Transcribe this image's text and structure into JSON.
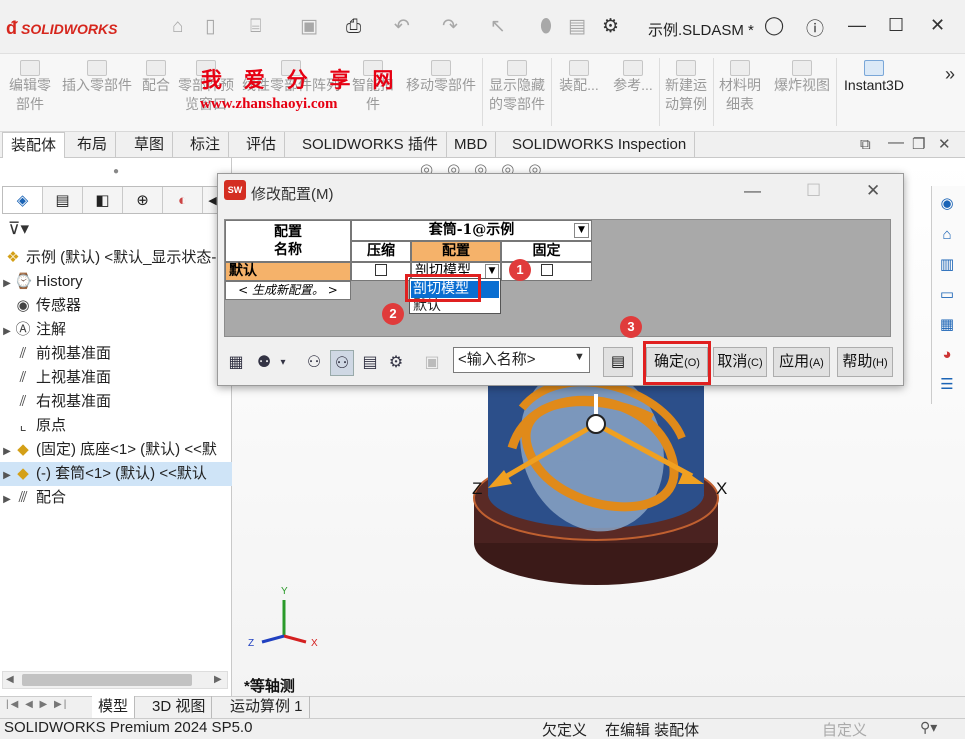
{
  "app": {
    "logo_text": "SOLIDWORKS",
    "document_title": "示例.SLDASM *"
  },
  "watermark": {
    "line1": "我 爱 分 享 网",
    "line2": "www.zhanshaoyi.com"
  },
  "ribbon": {
    "buttons": [
      {
        "l1": "编辑零",
        "l2": "部件"
      },
      {
        "l1": "插入零部件",
        "l2": ""
      },
      {
        "l1": "配合",
        "l2": ""
      },
      {
        "l1": "零部件预",
        "l2": "览窗口"
      },
      {
        "l1": "线性零部件阵列",
        "l2": ""
      },
      {
        "l1": "智能扣",
        "l2": "件"
      },
      {
        "l1": "移动零部件",
        "l2": ""
      },
      {
        "l1": "显示隐藏",
        "l2": "的零部件"
      },
      {
        "l1": "装配...",
        "l2": ""
      },
      {
        "l1": "参考...",
        "l2": ""
      },
      {
        "l1": "新建运",
        "l2": "动算例"
      },
      {
        "l1": "材料明",
        "l2": "细表"
      },
      {
        "l1": "爆炸视图",
        "l2": ""
      },
      {
        "l1": "Instant3D",
        "l2": ""
      }
    ],
    "more": "»"
  },
  "tabs": [
    "装配体",
    "布局",
    "草图",
    "标注",
    "评估",
    "SOLIDWORKS 插件",
    "MBD",
    "SOLIDWORKS Inspection"
  ],
  "tree": [
    {
      "text": "示例 (默认) <默认_显示状态-",
      "icon": "assembly-icon",
      "arrow": ""
    },
    {
      "text": "History",
      "icon": "history-icon",
      "arrow": "▶"
    },
    {
      "text": "传感器",
      "icon": "sensor-icon",
      "arrow": ""
    },
    {
      "text": "注解",
      "icon": "annotation-icon",
      "arrow": "▶"
    },
    {
      "text": "前视基准面",
      "icon": "plane-icon",
      "arrow": ""
    },
    {
      "text": "上视基准面",
      "icon": "plane-icon",
      "arrow": ""
    },
    {
      "text": "右视基准面",
      "icon": "plane-icon",
      "arrow": ""
    },
    {
      "text": "原点",
      "icon": "origin-icon",
      "arrow": ""
    },
    {
      "text": "(固定) 底座<1> (默认) <<默",
      "icon": "part-icon",
      "arrow": "▶"
    },
    {
      "text": "(-) 套筒<1> (默认) <<默认",
      "icon": "part-icon",
      "arrow": "▶"
    },
    {
      "text": "配合",
      "icon": "mates-icon",
      "arrow": "▶"
    }
  ],
  "dialog": {
    "title": "修改配置(M)",
    "header_config_name": "配置\n名称",
    "header_component": "套筒-1@示例",
    "col_suppress": "压缩",
    "col_config": "配置",
    "col_fixed": "固定",
    "row_default": "默认",
    "current_value": "剖切模型",
    "new_config": "< 生成新配置。 >",
    "options": [
      "剖切模型",
      "默认"
    ],
    "name_input_placeholder": "<输入名称>",
    "ok": "确定",
    "ok_key": "(O)",
    "cancel": "取消",
    "cancel_key": "(C)",
    "apply": "应用",
    "apply_key": "(A)",
    "help": "帮助",
    "help_key": "(H)",
    "badges": [
      "1",
      "2",
      "3"
    ]
  },
  "viewport": {
    "axis_x": "X",
    "axis_z": "Z",
    "triad_x": "X",
    "triad_y": "Y",
    "triad_z": "Z",
    "view_label": "*等轴测"
  },
  "bottom_tabs": [
    "模型",
    "3D 视图",
    "运动算例 1"
  ],
  "status": {
    "product": "SOLIDWORKS Premium 2024 SP5.0",
    "definition": "欠定义",
    "mode": "在编辑 装配体",
    "custom": "自定义"
  },
  "colors": {
    "accent": "#d6261d",
    "highlight": "#0a6ed1",
    "annot": "#e02020"
  }
}
